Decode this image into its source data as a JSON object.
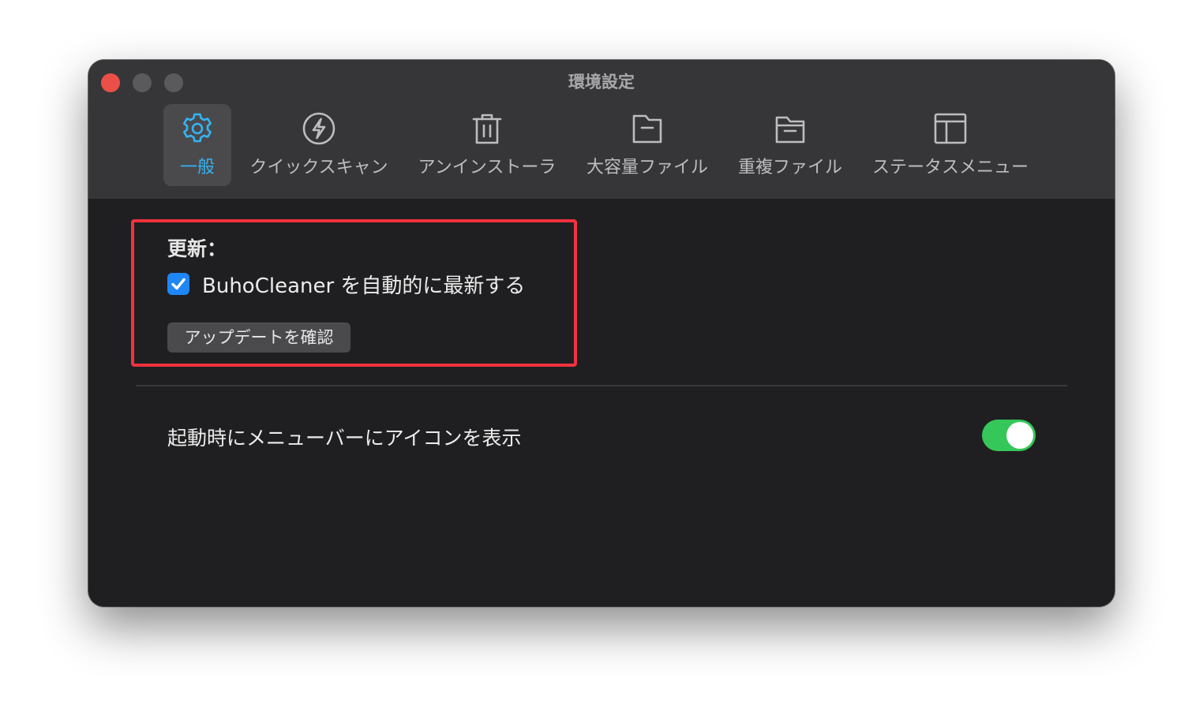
{
  "window": {
    "title": "環境設定"
  },
  "tabs": [
    {
      "label": "一般",
      "icon": "gear-icon",
      "active": true
    },
    {
      "label": "クイックスキャン",
      "icon": "lightning-icon",
      "active": false
    },
    {
      "label": "アンインストーラ",
      "icon": "trash-icon",
      "active": false
    },
    {
      "label": "大容量ファイル",
      "icon": "folder-icon",
      "active": false
    },
    {
      "label": "重複ファイル",
      "icon": "folders-icon",
      "active": false
    },
    {
      "label": "ステータスメニュー",
      "icon": "layout-panel-icon",
      "active": false
    }
  ],
  "update": {
    "section_label": "更新：",
    "auto_update_label": "BuhoCleaner を自動的に最新する",
    "auto_update_checked": true,
    "check_button_label": "アップデートを確認"
  },
  "menubar": {
    "label": "起動時にメニューバーにアイコンを表示",
    "toggle_on": true
  },
  "colors": {
    "accent": "#34b4f2",
    "highlight_box": "#f1323f",
    "toggle_on": "#35c759",
    "checkbox": "#1e86f5"
  }
}
